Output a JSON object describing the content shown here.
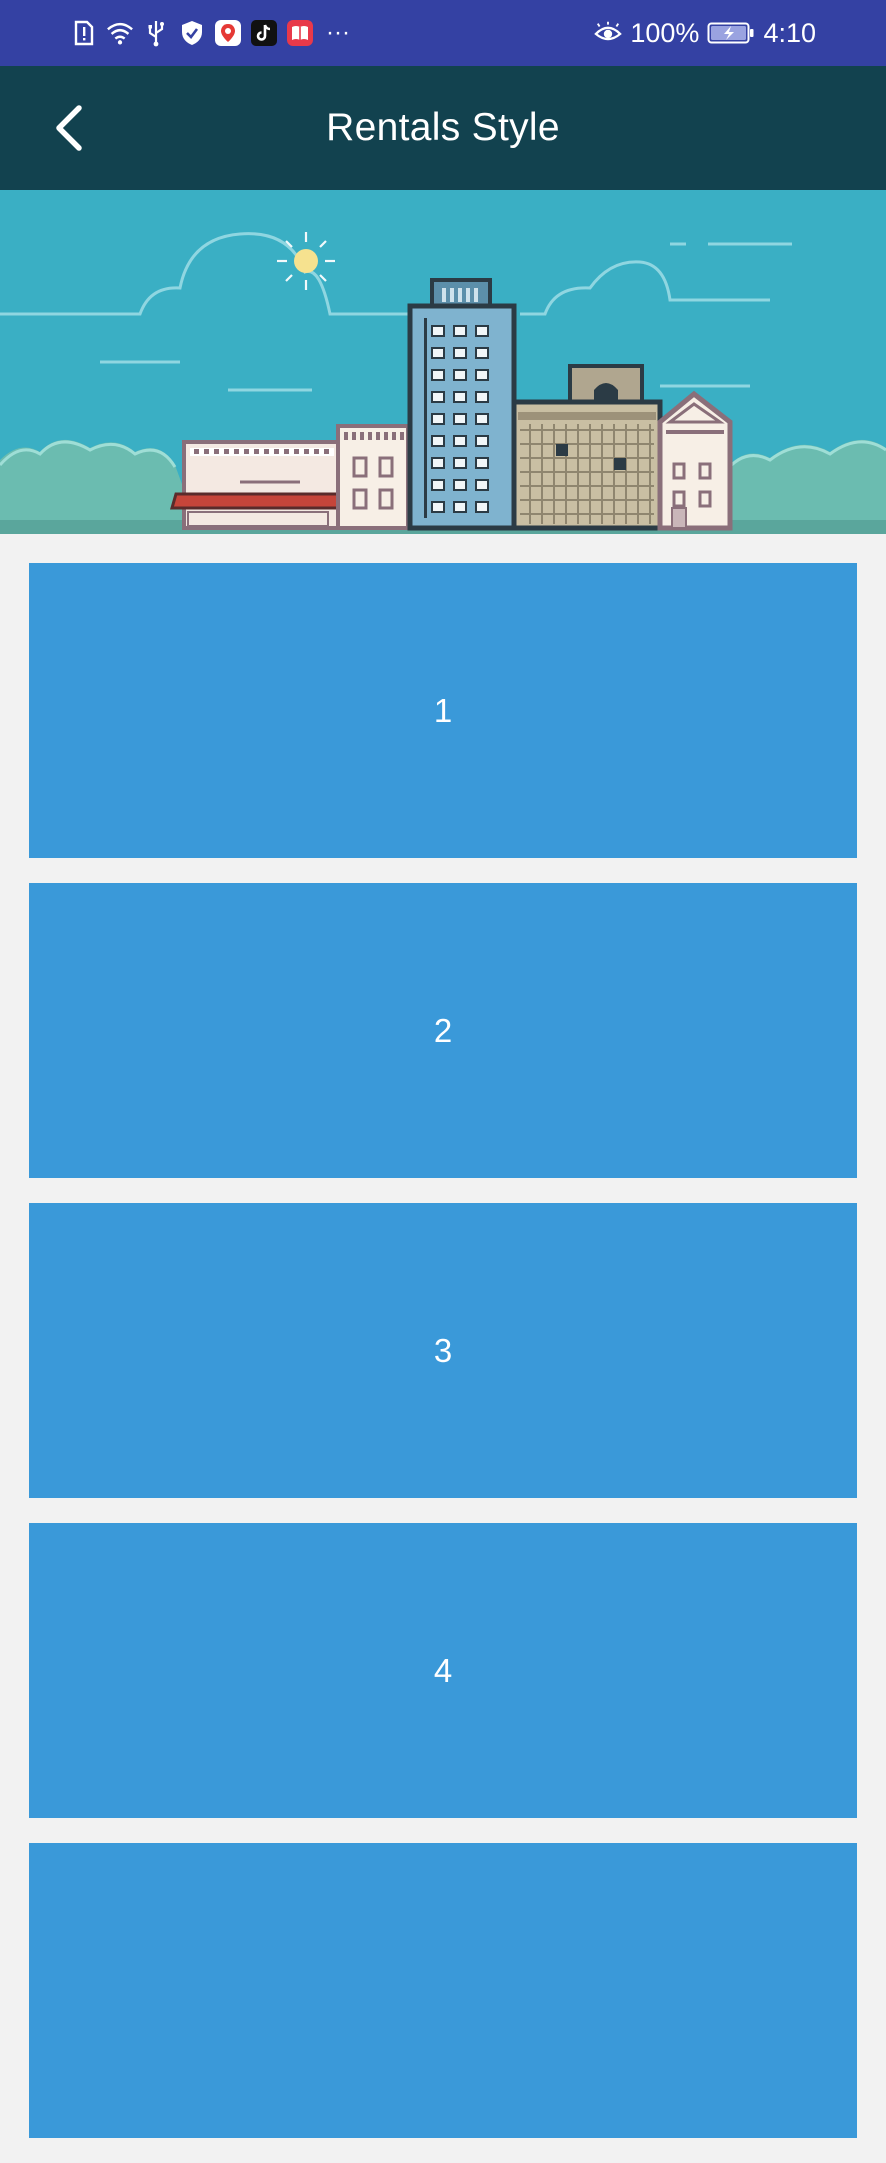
{
  "status_bar": {
    "battery": "100%",
    "time": "4:10",
    "more": "···"
  },
  "app_bar": {
    "title": "Rentals Style"
  },
  "items": [
    "1",
    "2",
    "3",
    "4",
    ""
  ]
}
